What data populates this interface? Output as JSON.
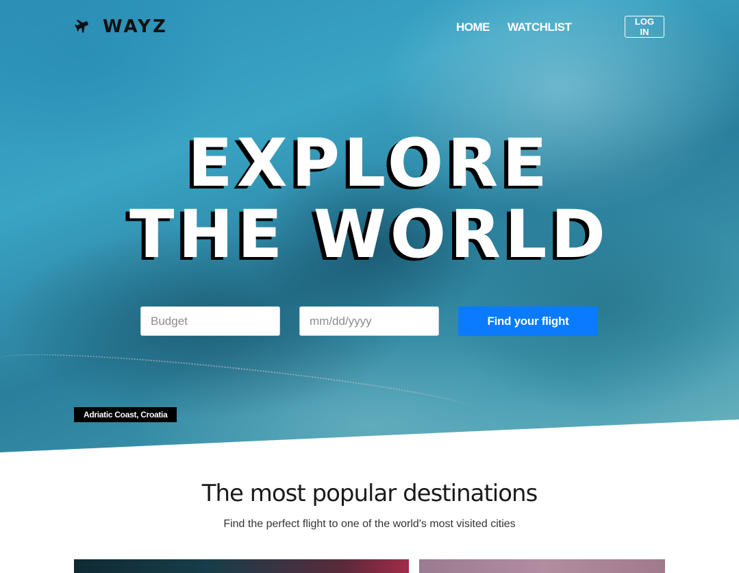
{
  "brand": {
    "name": "WAYZ",
    "icon": "airplane-icon"
  },
  "nav": {
    "home": "HOME",
    "watchlist": "WATCHLIST",
    "login": "LOG IN"
  },
  "hero": {
    "headline_line1": "EXPLORE",
    "headline_line2": "THE WORLD",
    "location": "Adriatic Coast, Croatia"
  },
  "search": {
    "budget_placeholder": "Budget",
    "date_placeholder": "mm/dd/yyyy",
    "submit_label": "Find your flight"
  },
  "destinations": {
    "title": "The most popular destinations",
    "subtitle": "Find the perfect flight to one of the world's most visited cities"
  },
  "colors": {
    "accent": "#0a7bff",
    "text_dark": "#1a1a1a"
  }
}
